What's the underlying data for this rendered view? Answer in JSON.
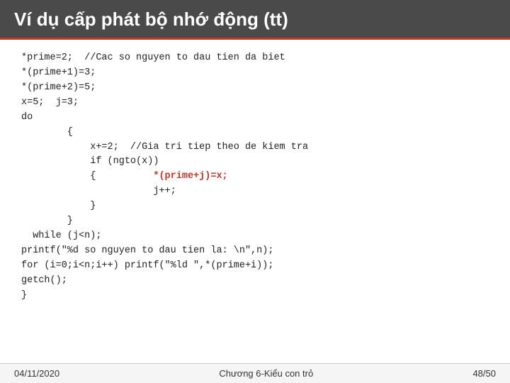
{
  "title": "Ví dụ cấp phát bộ nhớ động (tt)",
  "code": {
    "lines": [
      {
        "id": 1,
        "text": "*prime=2;  //Cac so nguyen to dau tien da biet",
        "highlight": false
      },
      {
        "id": 2,
        "text": "*(prime+1)=3;",
        "highlight": false
      },
      {
        "id": 3,
        "text": "*(prime+2)=5;",
        "highlight": false
      },
      {
        "id": 4,
        "text": "x=5;  j=3;",
        "highlight": false
      },
      {
        "id": 5,
        "text": "do",
        "highlight": false
      },
      {
        "id": 6,
        "text": "        {",
        "highlight": false
      },
      {
        "id": 7,
        "text": "            x+=2;  //Gia tri tiep theo de kiem tra",
        "highlight": false
      },
      {
        "id": 8,
        "text": "            if (ngto(x))",
        "highlight": false
      },
      {
        "id": 9,
        "text": "            {          *(prime+j)=x;",
        "highlight": true
      },
      {
        "id": 10,
        "text": "                       j++;",
        "highlight": false
      },
      {
        "id": 11,
        "text": "            }",
        "highlight": false
      },
      {
        "id": 12,
        "text": "        }",
        "highlight": false
      },
      {
        "id": 13,
        "text": "  while (j<n);",
        "highlight": false
      },
      {
        "id": 14,
        "text": "printf(\"%d so nguyen to dau tien la: \\n\",n);",
        "highlight": false
      },
      {
        "id": 15,
        "text": "for (i=0;i<n;i++) printf(\"%ld \",*(prime+i));",
        "highlight": false
      },
      {
        "id": 16,
        "text": "getch();",
        "highlight": false
      },
      {
        "id": 17,
        "text": "}",
        "highlight": false
      }
    ]
  },
  "footer": {
    "date": "04/11/2020",
    "chapter": "Chương 6-Kiểu con trỏ",
    "page": "48/50"
  }
}
